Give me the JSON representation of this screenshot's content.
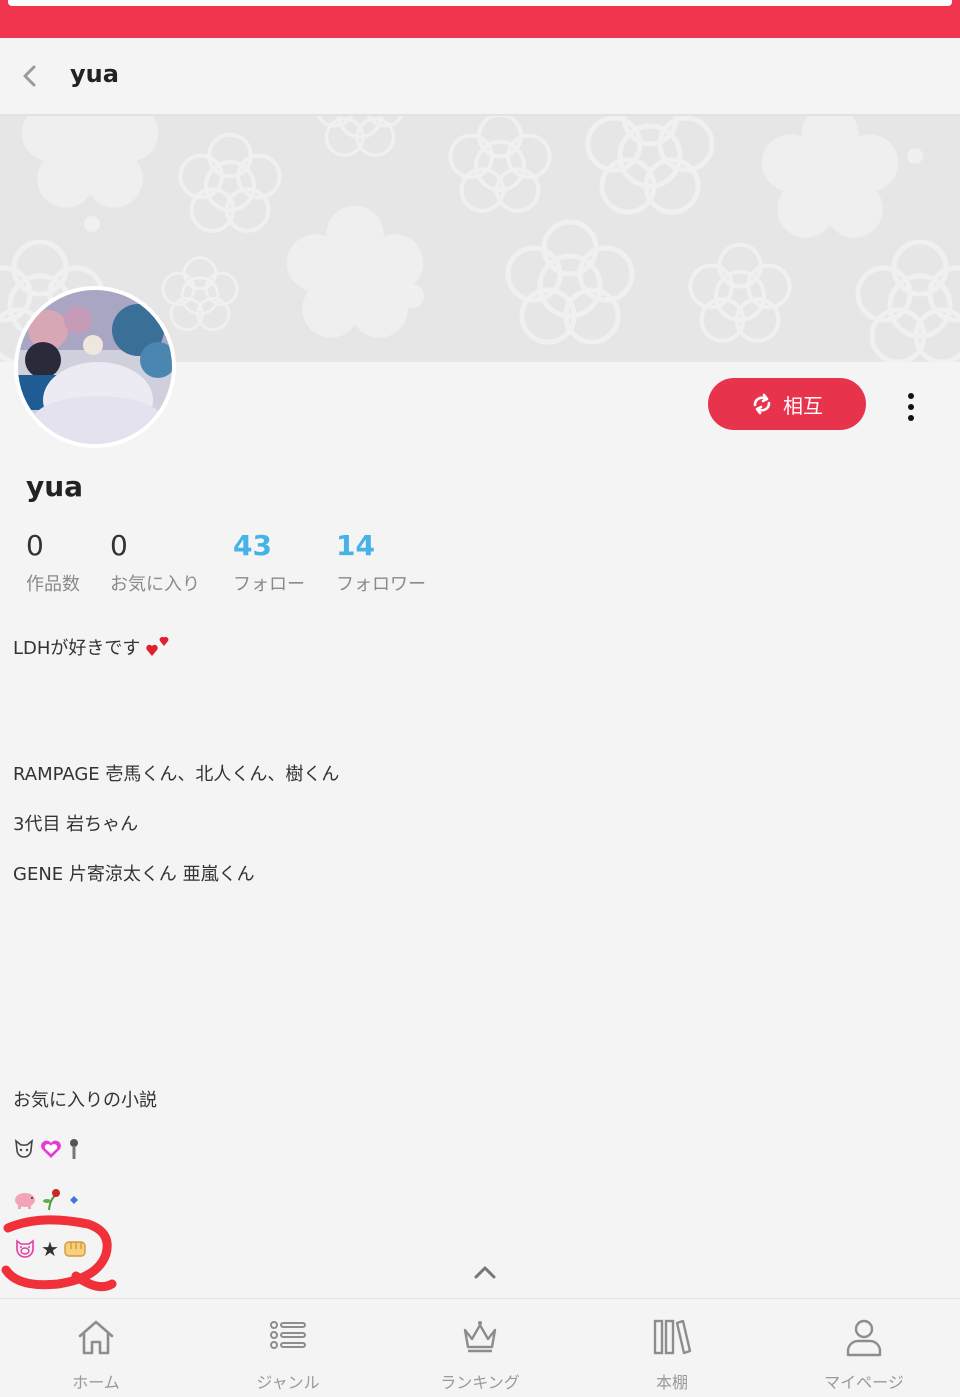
{
  "header": {
    "back_icon": "chevron-left-icon",
    "title": "yua"
  },
  "profile": {
    "name": "yua",
    "mutual_button": "相互",
    "stats": [
      {
        "value": "0",
        "label": "作品数"
      },
      {
        "value": "0",
        "label": "お気に入り"
      },
      {
        "value": "43",
        "label": "フォロー"
      },
      {
        "value": "14",
        "label": "フォロワー"
      }
    ]
  },
  "bio": {
    "line1": "LDHが好きです",
    "line2": "RAMPAGE 壱馬くん、北人くん、樹くん",
    "line3": "3代目 岩ちゃん",
    "line4": "GENE 片寄涼太くん 亜嵐くん",
    "line5": "お気に入りの小説",
    "star": "★"
  },
  "nav": [
    {
      "label": "ホーム",
      "icon": "home-icon"
    },
    {
      "label": "ジャンル",
      "icon": "list-icon"
    },
    {
      "label": "ランキング",
      "icon": "crown-icon"
    },
    {
      "label": "本棚",
      "icon": "bookshelf-icon"
    },
    {
      "label": "マイページ",
      "icon": "person-icon"
    }
  ],
  "colors": {
    "accent": "#e8334c",
    "statusbar": "#f2354f",
    "link": "#46b3e6"
  }
}
